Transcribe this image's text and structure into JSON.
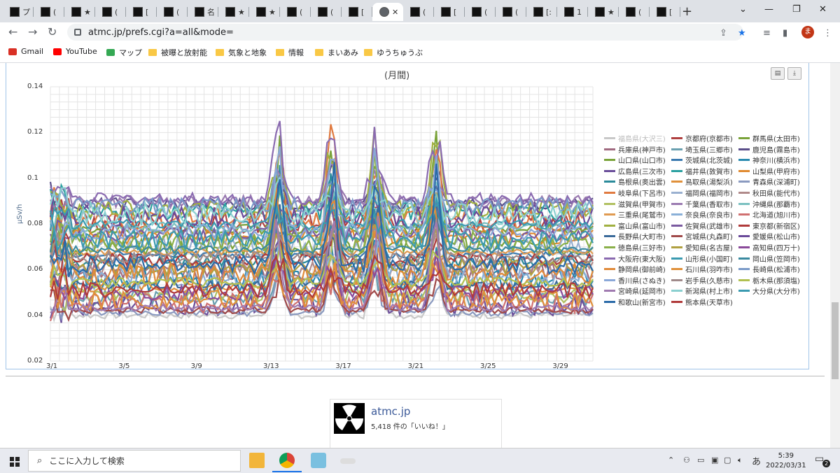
{
  "browser": {
    "tabs": [
      {
        "label": "プ",
        "type": "info"
      },
      {
        "label": "(",
        "type": "x"
      },
      {
        "label": "★",
        "type": "x"
      },
      {
        "label": "(",
        "type": "x"
      },
      {
        "label": "[",
        "type": "x"
      },
      {
        "label": "(",
        "type": "x"
      },
      {
        "label": "名",
        "type": "x"
      },
      {
        "label": "★",
        "type": "x"
      },
      {
        "label": "★",
        "type": "x"
      },
      {
        "label": "(",
        "type": "x"
      },
      {
        "label": "(",
        "type": "x"
      },
      {
        "label": "[",
        "type": "x"
      },
      {
        "label": "✕",
        "type": "active"
      },
      {
        "label": "(",
        "type": "x"
      },
      {
        "label": "[",
        "type": "x"
      },
      {
        "label": "(",
        "type": "x"
      },
      {
        "label": "(",
        "type": "x"
      },
      {
        "label": "[:",
        "type": "x"
      },
      {
        "label": "1",
        "type": "x"
      },
      {
        "label": "★",
        "type": "x"
      },
      {
        "label": "(",
        "type": "x"
      },
      {
        "label": "[",
        "type": "x"
      }
    ],
    "url": "atmc.jp/prefs.cgi?a=all&mode=",
    "avatar_letter": "ま",
    "bookmarks": [
      {
        "label": "Gmail",
        "icon": "gmail-icon"
      },
      {
        "label": "YouTube",
        "icon": "youtube-icon"
      },
      {
        "label": "マップ",
        "icon": "maps-icon"
      },
      {
        "label": "被曝と放射能",
        "icon": "folder-icon"
      },
      {
        "label": "気象と地象",
        "icon": "folder-icon"
      },
      {
        "label": "情報",
        "icon": "folder-icon"
      },
      {
        "label": "まいあみ",
        "icon": "folder-icon"
      },
      {
        "label": "ゆうちゅうぶ",
        "icon": "folder-icon"
      }
    ]
  },
  "chart_data": {
    "type": "line",
    "title": "(月間)",
    "ylabel": "μSv/h",
    "ylim": [
      0.02,
      0.14
    ],
    "yticks": [
      "0.14",
      "0.12",
      "0.1",
      "0.08",
      "0.06",
      "0.04",
      "0.02"
    ],
    "xticks": [
      "3/1",
      "3/5",
      "3/9",
      "3/13",
      "3/17",
      "3/21",
      "3/25",
      "3/29"
    ],
    "grid": true,
    "legend_position": "right",
    "series": [
      {
        "name": "福島県(大沢三)",
        "color": "#c8c8c8"
      },
      {
        "name": "京都府(京都市)",
        "color": "#b04040"
      },
      {
        "name": "群馬県(太田市)",
        "color": "#7aa33a"
      },
      {
        "name": "兵庫県(神戸市)",
        "color": "#a06a80"
      },
      {
        "name": "埼玉県(三郷市)",
        "color": "#6aa0b0"
      },
      {
        "name": "鹿児島(霧島市)",
        "color": "#5a4e8a"
      },
      {
        "name": "山口県(山口市)",
        "color": "#7aa33a"
      },
      {
        "name": "茨城県(北茨城)",
        "color": "#3a7ab0"
      },
      {
        "name": "神奈川(横浜市)",
        "color": "#2a8ab0"
      },
      {
        "name": "広島県(三次市)",
        "color": "#6a4e9a"
      },
      {
        "name": "福井県(敦賀市)",
        "color": "#2aa0a0"
      },
      {
        "name": "山梨県(甲府市)",
        "color": "#e08a30"
      },
      {
        "name": "島根県(奥出雲)",
        "color": "#2a8a9a"
      },
      {
        "name": "鳥取県(湯梨浜)",
        "color": "#e0903a"
      },
      {
        "name": "青森県(深浦町)",
        "color": "#8a9ac0"
      },
      {
        "name": "岐阜県(下呂市)",
        "color": "#e07a40"
      },
      {
        "name": "福岡県(福岡市)",
        "color": "#9ab0d0"
      },
      {
        "name": "秋田県(能代市)",
        "color": "#b08a8a"
      },
      {
        "name": "滋賀県(甲賀市)",
        "color": "#b0c060"
      },
      {
        "name": "千葉県(香取市)",
        "color": "#9a7ab0"
      },
      {
        "name": "沖縄県(那覇市)",
        "color": "#7ac0c0"
      },
      {
        "name": "三重県(尾鷲市)",
        "color": "#e09a50"
      },
      {
        "name": "奈良県(奈良市)",
        "color": "#8ab0d8"
      },
      {
        "name": "北海道(旭川市)",
        "color": "#d07070"
      },
      {
        "name": "富山県(富山市)",
        "color": "#a0b040"
      },
      {
        "name": "佐賀県(武雄市)",
        "color": "#7a5aa0"
      },
      {
        "name": "東京都(新宿区)",
        "color": "#b03a3a"
      },
      {
        "name": "長野県(大町市)",
        "color": "#3a6a9a"
      },
      {
        "name": "宮城県(丸森町)",
        "color": "#a04a4a"
      },
      {
        "name": "愛媛県(松山市)",
        "color": "#6a4a9a"
      },
      {
        "name": "徳島県(三好市)",
        "color": "#8ab04a"
      },
      {
        "name": "愛知県(名古屋)",
        "color": "#b0a040"
      },
      {
        "name": "高知県(四万十)",
        "color": "#8a4a9a"
      },
      {
        "name": "大阪府(東大阪)",
        "color": "#8a6ab0"
      },
      {
        "name": "山形県(小国町)",
        "color": "#3a9ab0"
      },
      {
        "name": "岡山県(笠岡市)",
        "color": "#3a8aa0"
      },
      {
        "name": "静岡県(御前崎)",
        "color": "#e08a3a"
      },
      {
        "name": "石川県(羽咋市)",
        "color": "#e0903a"
      },
      {
        "name": "長崎県(松浦市)",
        "color": "#7a9ac8"
      },
      {
        "name": "香川県(さぬき)",
        "color": "#8aa8d8"
      },
      {
        "name": "岩手県(久慈市)",
        "color": "#a08a8a"
      },
      {
        "name": "栃木県(那須塩)",
        "color": "#b0c050"
      },
      {
        "name": "宮崎県(延岡市)",
        "color": "#a07ab0"
      },
      {
        "name": "新潟県(村上市)",
        "color": "#8ad0d0"
      },
      {
        "name": "大分県(大分市)",
        "color": "#3a9ab0"
      },
      {
        "name": "和歌山(新宮市)",
        "color": "#2a6aa8"
      },
      {
        "name": "熊本県(天草市)",
        "color": "#b03a3a"
      }
    ]
  },
  "facebook": {
    "name": "atmc.jp",
    "likes": "5,418 件の「いいね！」"
  },
  "taskbar": {
    "search_placeholder": "ここに入力して検索",
    "time": "5:39",
    "date": "2022/03/31",
    "ime": "あ",
    "notif_count": "2"
  }
}
